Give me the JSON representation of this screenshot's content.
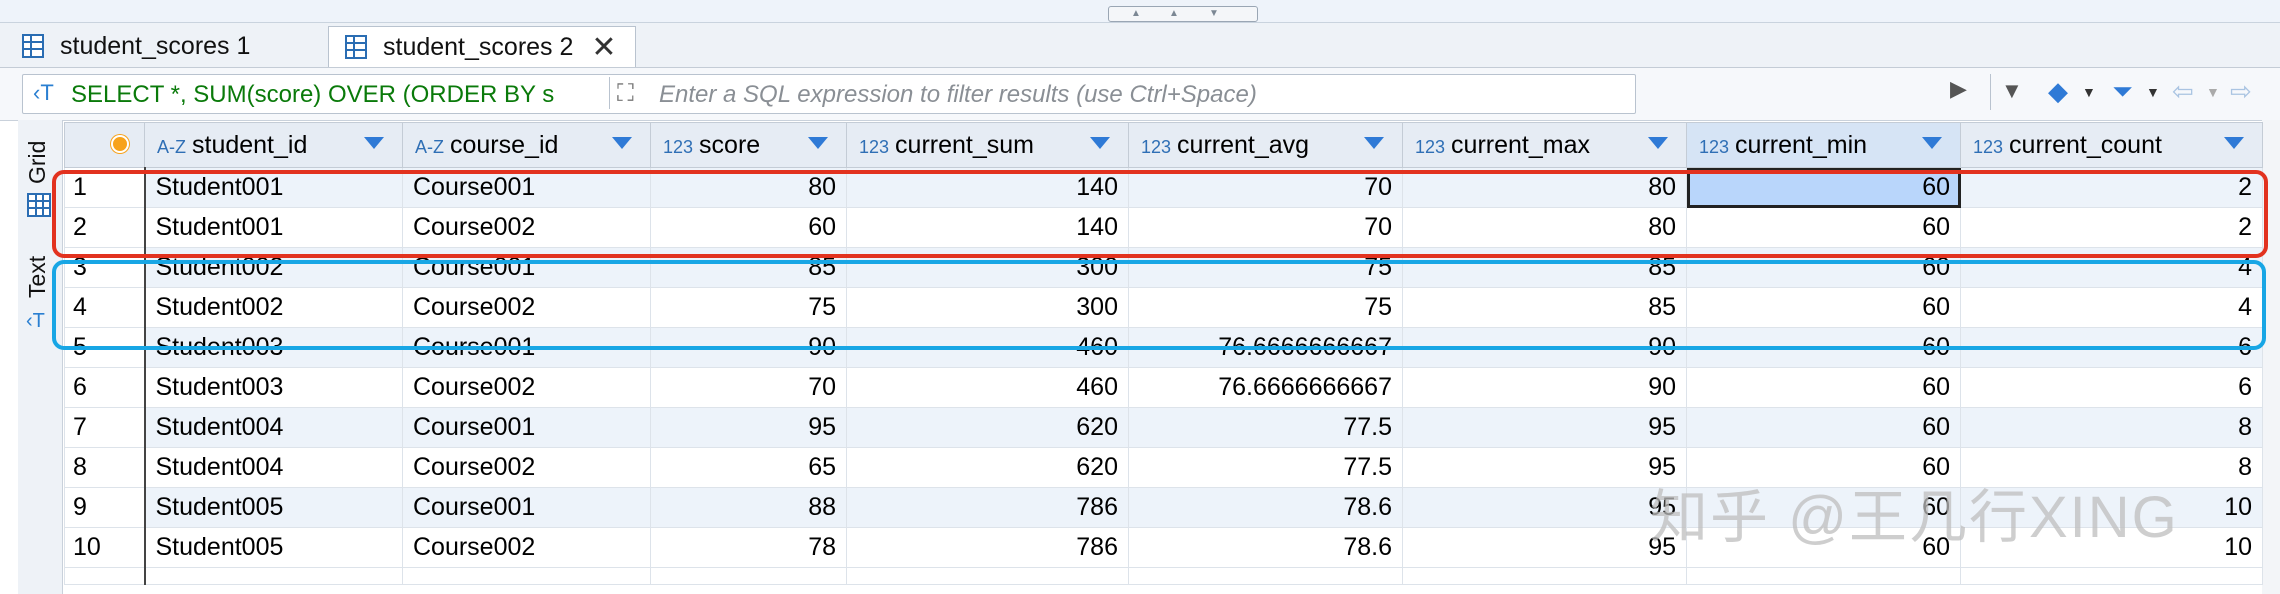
{
  "tabs": [
    {
      "label": "student_scores 1",
      "active": false
    },
    {
      "label": "student_scores 2",
      "active": true
    }
  ],
  "filter": {
    "sql_text": "SELECT *, SUM(score) OVER (ORDER BY s",
    "placeholder": "Enter a SQL expression to filter results (use Ctrl+Space)"
  },
  "side_panel": {
    "grid_label": "Grid",
    "text_label": "Text"
  },
  "columns": [
    {
      "type": "A-Z",
      "name": "student_id"
    },
    {
      "type": "A-Z",
      "name": "course_id"
    },
    {
      "type": "123",
      "name": "score"
    },
    {
      "type": "123",
      "name": "current_sum"
    },
    {
      "type": "123",
      "name": "current_avg"
    },
    {
      "type": "123",
      "name": "current_max"
    },
    {
      "type": "123",
      "name": "current_min"
    },
    {
      "type": "123",
      "name": "current_count"
    }
  ],
  "rows": [
    [
      "1",
      "Student001",
      "Course001",
      "80",
      "140",
      "70",
      "80",
      "60",
      "2"
    ],
    [
      "2",
      "Student001",
      "Course002",
      "60",
      "140",
      "70",
      "80",
      "60",
      "2"
    ],
    [
      "3",
      "Student002",
      "Course001",
      "85",
      "300",
      "75",
      "85",
      "60",
      "4"
    ],
    [
      "4",
      "Student002",
      "Course002",
      "75",
      "300",
      "75",
      "85",
      "60",
      "4"
    ],
    [
      "5",
      "Student003",
      "Course001",
      "90",
      "460",
      "76.6666666667",
      "90",
      "60",
      "6"
    ],
    [
      "6",
      "Student003",
      "Course002",
      "70",
      "460",
      "76.6666666667",
      "90",
      "60",
      "6"
    ],
    [
      "7",
      "Student004",
      "Course001",
      "95",
      "620",
      "77.5",
      "95",
      "60",
      "8"
    ],
    [
      "8",
      "Student004",
      "Course002",
      "65",
      "620",
      "77.5",
      "95",
      "60",
      "8"
    ],
    [
      "9",
      "Student005",
      "Course001",
      "88",
      "786",
      "78.6",
      "95",
      "60",
      "10"
    ],
    [
      "10",
      "Student005",
      "Course002",
      "78",
      "786",
      "78.6",
      "95",
      "60",
      "10"
    ]
  ],
  "watermark": "知乎 @王几行XING",
  "colors": {
    "highlight_red": "#e2321f",
    "highlight_blue": "#18a6e5",
    "selected_cell": "#b9d6fb"
  }
}
